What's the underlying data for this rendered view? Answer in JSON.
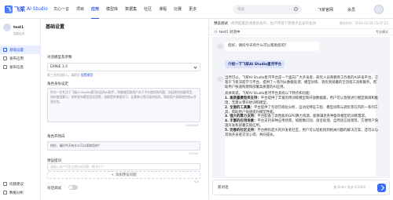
{
  "brand": {
    "logo_mark": "飞",
    "name": "飞桨",
    "product": "AI Studio"
  },
  "nav": [
    {
      "label": "文心一言"
    },
    {
      "label": "项目"
    },
    {
      "label": "应用"
    },
    {
      "label": "模型库"
    },
    {
      "label": "数据集"
    },
    {
      "label": "社区"
    },
    {
      "label": "课程"
    },
    {
      "label": "比赛"
    },
    {
      "label": "更多"
    }
  ],
  "nav_active_index": 2,
  "search": {
    "placeholder": "搜索"
  },
  "header_right": {
    "paddle_link": "飞桨官网",
    "member": "会员"
  },
  "sidebar": {
    "user_name": "test1",
    "user_sub": "智能应用",
    "items": [
      {
        "label": "基础设置",
        "active": true
      },
      {
        "label": "发布应用",
        "active": false
      },
      {
        "label": "发布信息",
        "active": false
      }
    ],
    "bottom_items": [
      {
        "label": "问题建议"
      },
      {
        "label": "数据分析"
      }
    ]
  },
  "config": {
    "title": "基础设置",
    "model_label": "对话模型及参数",
    "model_value": "ERNIE 3.5",
    "model_hint": "第三方应用接入，请前往",
    "model_hint_link": "配置模型",
    "role_label": "角色身份设定",
    "role_text": "作为一名专注于飞桨AI Studio星河社区的AI助手，你能够回答用户关于平台使用的问题，包括如何创建项目、如何使用算力、如何发布模型及应用等，也能提供课程学习、比赛参与等方面的指导，帮助用户高效地完成AI开发任务。",
    "role_count": "128/2000",
    "opening_label": "角色开场白",
    "opening_text": "你好，请问今天有什么可以帮助您的？",
    "opening_count": "17/100",
    "suggest_label": "预设提问",
    "suggest_placeholder": "请输入用户可能会提出的问题（最多5个）",
    "add_label": "+ 添加预设问题",
    "suggest_count": "0/5",
    "toggle_label": "对话调试",
    "toggle_on": false
  },
  "preview": {
    "title": "预览调试",
    "warning": "修改配置后请重新发布，生产环境下需要点击发布生效",
    "time": "保存时间：2024-02-26 15:47:22",
    "bot_name": "test1 对话中",
    "mode": "专业模式",
    "greeting": "您好，请问今天有什么可以帮助您的？",
    "user_message": "介绍一下飞桨AI Studio星河平台",
    "reply_intro": "当然可以。飞桨AI Studio星河平台是一个面向广大开发者、研究人员和教育工作者的AI开发平台，它基于飞桨深度学习平台，提供了一系列从数据处理、模型训练、调优到部署的全流程工具和服务，帮助用户快速构建和部署高质量的AI应用。",
    "reply_list_intro": "具体来说，飞桨AI Studio星河平台具有以下特点和功能：",
    "reply_points": [
      {
        "title": "1. 高质量模型库支持：",
        "text": "平台提供了丰富的预训练模型和开放数据集，用户可以直接进行模型微调和推理，无需从零开始训练模型。"
      },
      {
        "title": "2. 全面的工具集：",
        "text": "平台提供了包括可视化分析、自动化特征工程、模型训练与调优等在内的一系列工具，帮助用户快速提升模型性能。"
      },
      {
        "title": "3. 强大的算力支持：",
        "text": "平台配备了高性能的GPU算力资源，能够满足各种复杂模型的训练需求。"
      },
      {
        "title": "4. 丰富的应用场景：",
        "text": "平台支持多种应用场景，如图像识别、语音处理、自然语言处理等，方便用户快速开发和部署实际应用。"
      },
      {
        "title": "5. 完善的社区支持：",
        "text": "平台拥有庞大的开发者社区，用户可以轻松找到相关问题的解决方案，还可以与其他开发者交流心得、共同成长。"
      }
    ],
    "new_chat": "新对话",
    "composer_hint": "按 Enter 发送",
    "composer_count": "0/2000"
  },
  "colors": {
    "accent": "#2b55e6",
    "bubble_user": "#dbe3ff",
    "bg": "#f3f4f8"
  }
}
